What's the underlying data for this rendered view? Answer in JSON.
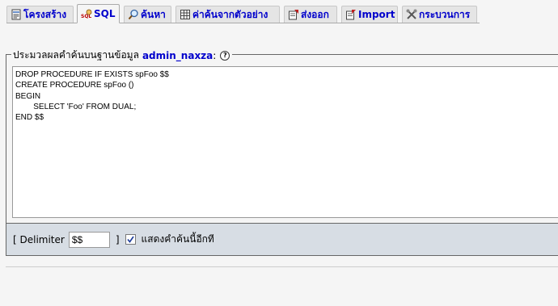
{
  "tabs": [
    {
      "label": "โครงสร้าง",
      "icon": "structure-icon",
      "active": false
    },
    {
      "label": "SQL",
      "icon": "sql-icon",
      "active": true
    },
    {
      "label": "ค้นหา",
      "icon": "search-icon",
      "active": false
    },
    {
      "label": "ค่าค้นจากตัวอย่าง",
      "icon": "query-icon",
      "active": false
    },
    {
      "label": "ส่งออก",
      "icon": "export-icon",
      "active": false
    },
    {
      "label": "Import",
      "icon": "import-icon",
      "active": false
    },
    {
      "label": "กระบวนการ",
      "icon": "operations-icon",
      "active": false
    }
  ],
  "query_box": {
    "legend_prefix": "ประมวลผลคำค้นบนฐานข้อมูล",
    "database": "admin_naxza",
    "colon": ":",
    "help_glyph": "?",
    "sql": "DROP PROCEDURE IF EXISTS spFoo $$\nCREATE PROCEDURE spFoo ()\nBEGIN\n        SELECT 'Foo' FROM DUAL;\nEND $$"
  },
  "footer": {
    "delimiter_label": "[ Delimiter",
    "delimiter_value": "$$",
    "close_bracket": "]",
    "show_again_label": "แสดงคำค้นนี้อีกที",
    "show_again_checked": true
  },
  "colors": {
    "tab_link": "#0000cc",
    "footer_bg": "#d7dde4",
    "page_bg": "#f5f5f5"
  }
}
